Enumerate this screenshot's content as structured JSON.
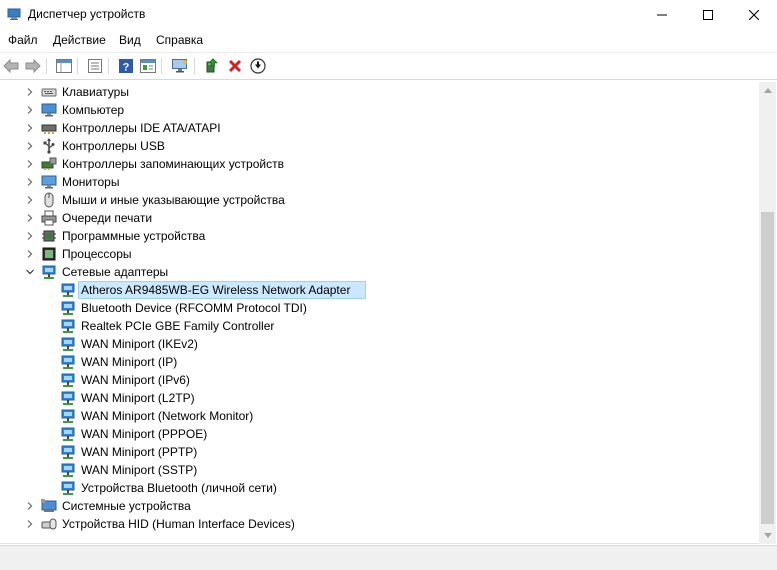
{
  "window": {
    "title": "Диспетчер устройств",
    "controls": [
      "minimize",
      "maximize",
      "close"
    ]
  },
  "menu": {
    "items": [
      "Файл",
      "Действие",
      "Вид",
      "Справка"
    ]
  },
  "toolbar": {
    "buttons": [
      "back-icon",
      "forward-icon",
      "properties-grid-icon",
      "list-view-icon",
      "help-icon",
      "details-icon",
      "monitor-scan-icon",
      "update-driver-icon",
      "uninstall-icon",
      "download-icon"
    ]
  },
  "tree": {
    "rows": [
      {
        "label": "Клавиатуры",
        "level": 1,
        "expanded": false,
        "icon": "keyboard-icon"
      },
      {
        "label": "Компьютер",
        "level": 1,
        "expanded": false,
        "icon": "computer-icon"
      },
      {
        "label": "Контроллеры IDE ATA/ATAPI",
        "level": 1,
        "expanded": false,
        "icon": "ide-controller-icon"
      },
      {
        "label": "Контроллеры USB",
        "level": 1,
        "expanded": false,
        "icon": "usb-icon"
      },
      {
        "label": "Контроллеры запоминающих устройств",
        "level": 1,
        "expanded": false,
        "icon": "storage-controller-icon"
      },
      {
        "label": "Мониторы",
        "level": 1,
        "expanded": false,
        "icon": "monitor-icon"
      },
      {
        "label": "Мыши и иные указывающие устройства",
        "level": 1,
        "expanded": false,
        "icon": "mouse-icon"
      },
      {
        "label": "Очереди печати",
        "level": 1,
        "expanded": false,
        "icon": "printer-icon"
      },
      {
        "label": "Программные устройства",
        "level": 1,
        "expanded": false,
        "icon": "software-device-icon"
      },
      {
        "label": "Процессоры",
        "level": 1,
        "expanded": false,
        "icon": "processor-icon"
      },
      {
        "label": "Сетевые адаптеры",
        "level": 1,
        "expanded": true,
        "icon": "network-adapter-icon"
      },
      {
        "label": "Atheros AR9485WB-EG Wireless Network Adapter",
        "level": 2,
        "selected": true,
        "icon": "network-adapter-icon"
      },
      {
        "label": "Bluetooth Device (RFCOMM Protocol TDI)",
        "level": 2,
        "icon": "network-adapter-icon"
      },
      {
        "label": "Realtek PCIe GBE Family Controller",
        "level": 2,
        "icon": "network-adapter-icon"
      },
      {
        "label": "WAN Miniport (IKEv2)",
        "level": 2,
        "icon": "network-adapter-icon"
      },
      {
        "label": "WAN Miniport (IP)",
        "level": 2,
        "icon": "network-adapter-icon"
      },
      {
        "label": "WAN Miniport (IPv6)",
        "level": 2,
        "icon": "network-adapter-icon"
      },
      {
        "label": "WAN Miniport (L2TP)",
        "level": 2,
        "icon": "network-adapter-icon"
      },
      {
        "label": "WAN Miniport (Network Monitor)",
        "level": 2,
        "icon": "network-adapter-icon"
      },
      {
        "label": "WAN Miniport (PPPOE)",
        "level": 2,
        "icon": "network-adapter-icon"
      },
      {
        "label": "WAN Miniport (PPTP)",
        "level": 2,
        "icon": "network-adapter-icon"
      },
      {
        "label": "WAN Miniport (SSTP)",
        "level": 2,
        "icon": "network-adapter-icon"
      },
      {
        "label": "Устройства Bluetooth (личной сети)",
        "level": 2,
        "icon": "network-adapter-icon"
      },
      {
        "label": "Системные устройства",
        "level": 1,
        "expanded": false,
        "icon": "system-device-icon"
      },
      {
        "label": "Устройства HID (Human Interface Devices)",
        "level": 1,
        "expanded": false,
        "icon": "hid-icon"
      }
    ]
  },
  "colors": {
    "selection_bg": "#cce8ff",
    "selection_border": "#99d1ff",
    "network_icon": "#2b88d8"
  }
}
